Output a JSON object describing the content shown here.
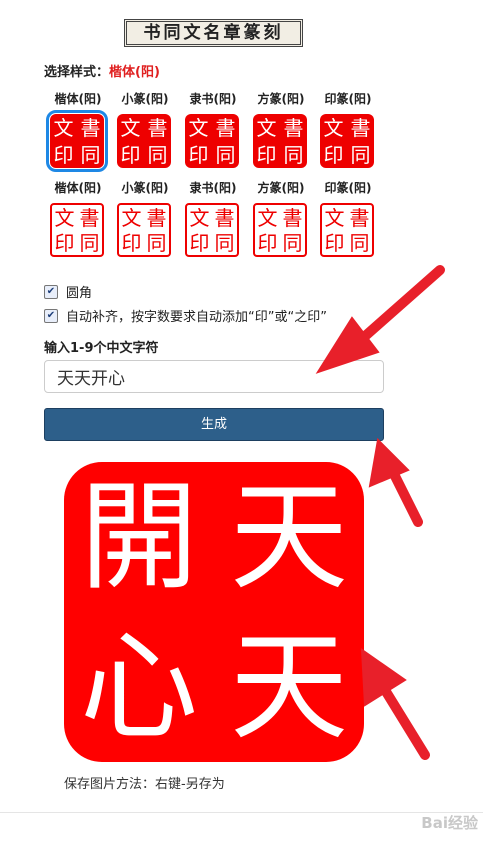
{
  "title": "书同文名章篆刻",
  "style_selected": {
    "label": "选择样式：",
    "value": "楷体(阳)"
  },
  "seal_chars": [
    "文",
    "書",
    "印",
    "同"
  ],
  "row1": [
    {
      "label": "楷体(阳)"
    },
    {
      "label": "小篆(阳)"
    },
    {
      "label": "隶书(阳)"
    },
    {
      "label": "方篆(阳)"
    },
    {
      "label": "印篆(阳)"
    }
  ],
  "row2": [
    {
      "label": "楷体(阳)"
    },
    {
      "label": "小篆(阳)"
    },
    {
      "label": "隶书(阳)"
    },
    {
      "label": "方篆(阳)"
    },
    {
      "label": "印篆(阳)"
    }
  ],
  "options": {
    "rounded": {
      "label": "圆角",
      "checked": true
    },
    "autofill": {
      "label": "自动补齐，按字数要求自动添加“印”或“之印”",
      "checked": true
    }
  },
  "input": {
    "label": "输入1-9个中文字符",
    "value": "天天开心"
  },
  "generate_button": "生成",
  "result_seal": [
    "開",
    "天",
    "心",
    "天"
  ],
  "save_hint": "保存图片方法：右键-另存为",
  "watermark": "Bai经验",
  "colors": {
    "seal_red": "#ff0000",
    "button_blue": "#2d5f8a",
    "accent_red": "#e02020",
    "arrow_red": "#e8202a"
  }
}
